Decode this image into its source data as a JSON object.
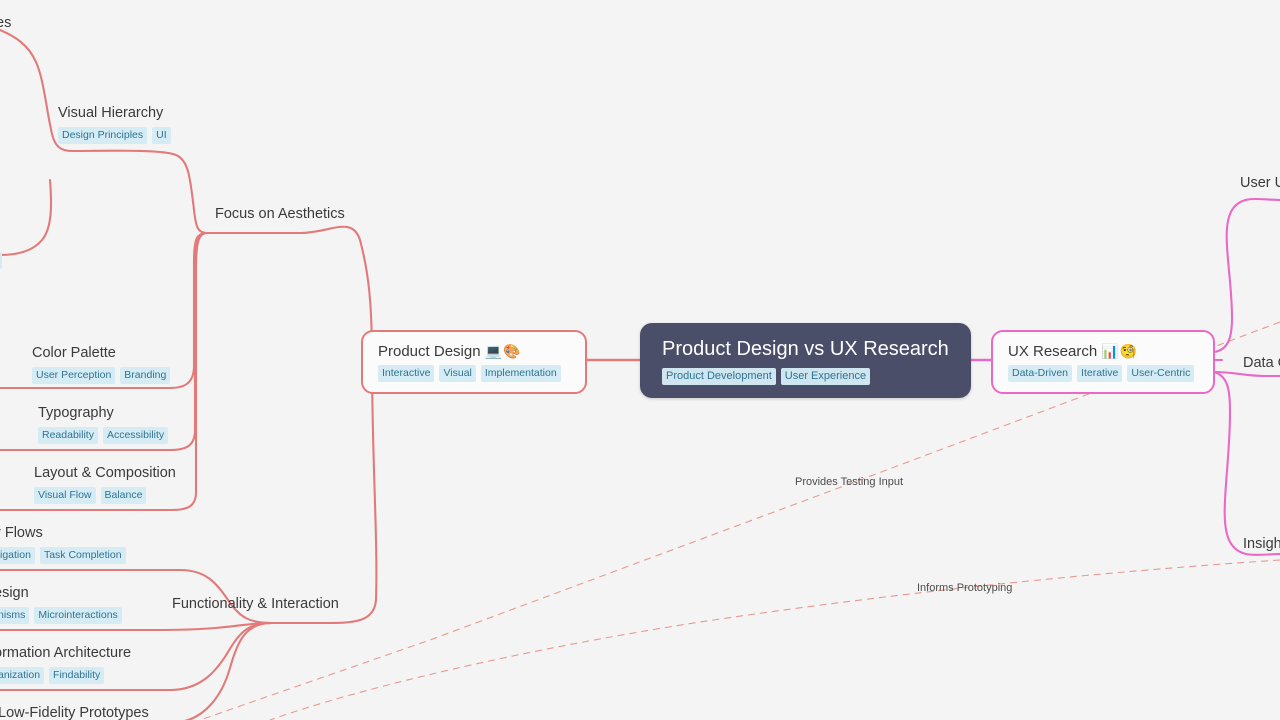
{
  "background_color": "#f4f4f4",
  "colors": {
    "root_bg": "#4a4e69",
    "root_text": "#ffffff",
    "left_branch": "#e27a79",
    "right_branch": "#e968c8",
    "tag_bg": "#d6ecf5",
    "tag_text": "#2f7391",
    "node_text": "#3a3a3a",
    "cross_link": "#e8897f"
  },
  "root": {
    "title": "Product Design vs UX Research",
    "tags": [
      "Product Development",
      "User Experience"
    ]
  },
  "left_branch": {
    "main": {
      "title": "Product Design",
      "emoji": "💻🎨",
      "tags": [
        "Interactive",
        "Visual",
        "Implementation"
      ]
    },
    "groups": [
      {
        "label": "Focus on Aesthetics",
        "children": [
          {
            "title": "Visual Hierarchy",
            "tags": [
              "Design Principles",
              "UI"
            ]
          },
          {
            "title": "Color Palette",
            "tags": [
              "User Perception",
              "Branding"
            ]
          },
          {
            "title": "Typography",
            "tags": [
              "Readability",
              "Accessibility"
            ]
          },
          {
            "title": "Layout & Composition",
            "tags": [
              "Visual Flow",
              "Balance"
            ]
          }
        ]
      },
      {
        "label": "Functionality & Interaction",
        "children": [
          {
            "title": "r Flows",
            "tags": [
              "igation",
              "Task Completion"
            ]
          },
          {
            "title": "esign",
            "tags": [
              "nisms",
              "Microinteractions"
            ]
          },
          {
            "title": "ormation Architecture",
            "tags": [
              "anization",
              "Findability"
            ]
          },
          {
            "title": "Low-Fidelity Prototypes",
            "tags": []
          }
        ]
      }
    ],
    "clipped_top_label": "es",
    "clipped_top_tag": "n"
  },
  "right_branch": {
    "main": {
      "title": "UX Research",
      "emoji": "📊🧐",
      "tags": [
        "Data-Driven",
        "Iterative",
        "User-Centric"
      ]
    },
    "groups": [
      {
        "label": "User U"
      },
      {
        "label": "Data C"
      },
      {
        "label": "Insigh"
      }
    ]
  },
  "cross_links": [
    {
      "label": "Provides Testing Input"
    },
    {
      "label": "Informs Prototyping"
    }
  ]
}
